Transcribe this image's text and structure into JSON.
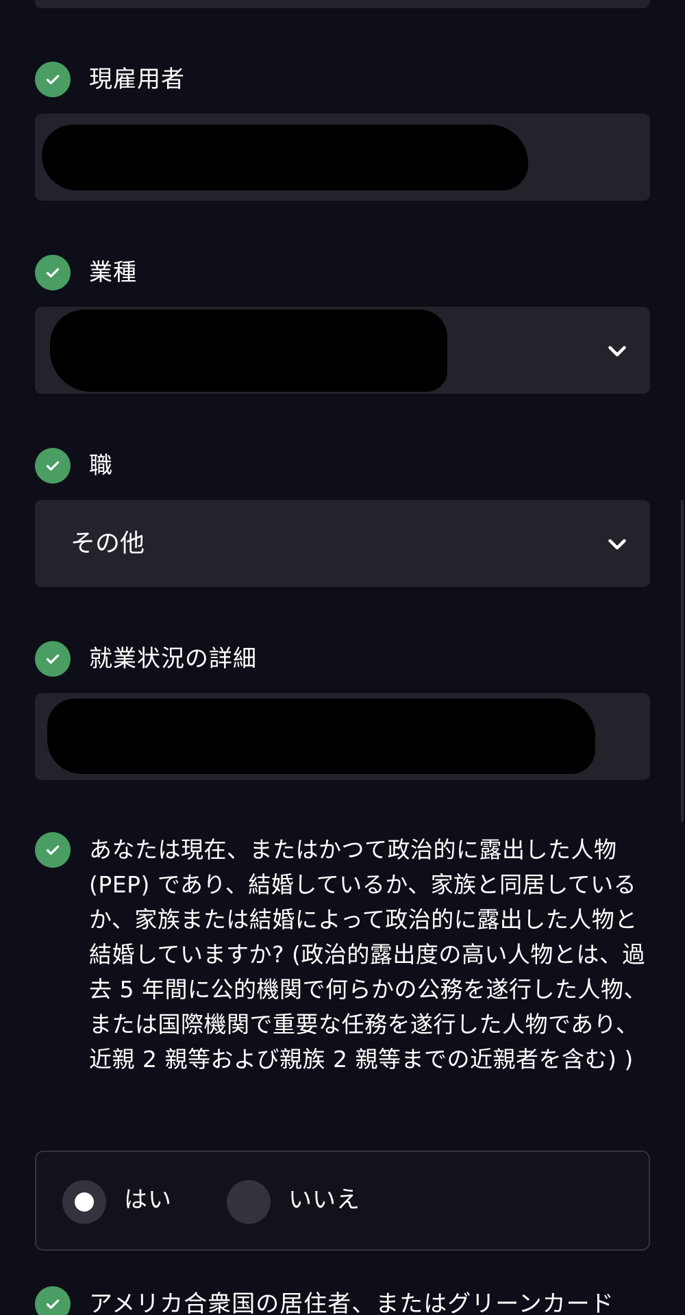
{
  "fields": [
    {
      "label": "現雇用者",
      "value": "",
      "redacted": true,
      "type": "text"
    },
    {
      "label": "業種",
      "value": "",
      "redacted": true,
      "type": "select"
    },
    {
      "label": "職",
      "value": "その他",
      "redacted": false,
      "type": "select"
    },
    {
      "label": "就業状況の詳細",
      "value": "",
      "redacted": true,
      "type": "text"
    }
  ],
  "pep_question": {
    "text": "あなたは現在、またはかつて政治的に露出した人物 (PEP) であり、結婚しているか、家族と同居しているか、家族または結婚によって政治的に露出した人物と結婚していますか? (政治的露出度の高い人物とは、過去 5 年間に公的機関で何らかの公務を遂行した人物、または国際機関で重要な任務を遂行した人物であり、近親 2 親等および親族 2 親等までの近親者を含む) )",
    "options": [
      {
        "label": "はい",
        "selected": true
      },
      {
        "label": "いいえ",
        "selected": false
      }
    ]
  },
  "next_question": {
    "text": "アメリカ合衆国の居住者、またはグリーンカード"
  },
  "icons": {
    "check": "check-circle-icon",
    "chevron": "chevron-down-icon"
  },
  "colors": {
    "background": "#0e0e18",
    "field": "#23232c",
    "check": "#4a9d63",
    "text": "#ffffff"
  }
}
